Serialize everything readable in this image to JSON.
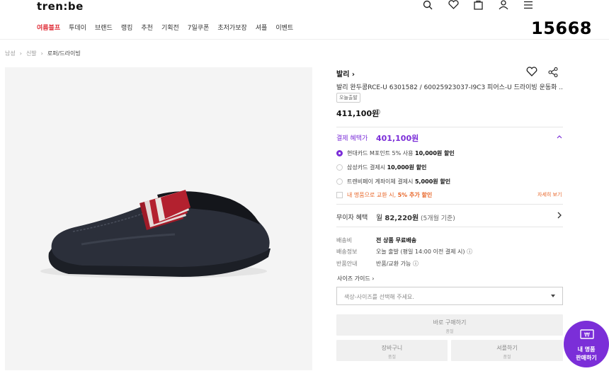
{
  "header": {
    "logo": "tren:be",
    "nav": [
      "여름블프",
      "투데이",
      "브랜드",
      "랭킹",
      "추천",
      "기획전",
      "7일쿠폰",
      "초저가보장",
      "셔플",
      "이벤트"
    ],
    "overlay_number": "15668",
    "icons": [
      "search-icon",
      "heart-icon",
      "bag-icon",
      "user-icon",
      "menu-icon"
    ]
  },
  "breadcrumb": [
    "남성",
    "신발",
    "로퍼/드라이빙"
  ],
  "product": {
    "brand": "발리",
    "name": "발리 완두콩RCE-U 6301582 / 60025923037-I9C3 피어스-U 드라이빙 운동화 ...",
    "tag": "오늘출발",
    "price": "411,100원"
  },
  "benefit": {
    "label": "결제 혜택가",
    "price": "401,100원",
    "options": [
      {
        "prefix": "현대카드 M포인트 5% 사용 ",
        "bold": "10,000원 할인"
      },
      {
        "prefix": "삼성카드 결제시 ",
        "bold": "10,000원 할인"
      },
      {
        "prefix": "트렌비페이 계좌이체 결제시 ",
        "bold": "5,000원 할인"
      }
    ],
    "extra": {
      "prefix": "내 명품으로 교환 시, ",
      "bold": "5% 추가 할인"
    },
    "detail_link": "자세히 보기"
  },
  "installment": {
    "label": "무이자 혜택",
    "prefix": "월 ",
    "value": "82,220원",
    "sub": " (5개월 기준)"
  },
  "shipping": [
    {
      "key": "배송비",
      "bold": "전 상품 무료배송",
      "rest": ""
    },
    {
      "key": "배송정보",
      "bold": "",
      "rest": "오늘 출발 (평일 14:00 이전 결제 시)"
    },
    {
      "key": "반품안내",
      "bold": "",
      "rest": "반품/교환 가능"
    }
  ],
  "size_guide": "사이즈 가이드",
  "select_placeholder": "색상-사이즈를 선택해 주세요.",
  "buttons": {
    "buy_now": {
      "label": "바로 구매하기",
      "sub": "품절"
    },
    "cart": {
      "label": "장바구니",
      "sub": "품절"
    },
    "shuffle": {
      "label": "셔플하기",
      "sub": "품절"
    }
  },
  "fab": {
    "line1": "내 명품",
    "line2": "판매하기"
  },
  "colors": {
    "accent": "#7b2ed8",
    "hot": "#e0303a",
    "orange": "#e8672a"
  }
}
